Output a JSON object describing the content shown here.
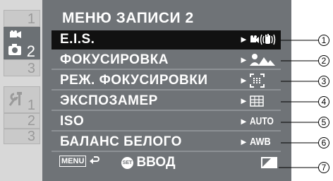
{
  "menu": {
    "title": "МЕНЮ ЗАПИСИ 2",
    "items": [
      {
        "label": "E.I.S.",
        "icon": "eis-video-hand-icon",
        "selected": true
      },
      {
        "label": "ФОКУСИРОВКА",
        "icon": "person-mountain-icon",
        "selected": false
      },
      {
        "label": "РЕЖ. ФОКУСИРОВКИ",
        "icon": "focus-frame-icon",
        "selected": false
      },
      {
        "label": "ЭКСПОЗАМЕР",
        "icon": "grid-metering-icon",
        "selected": false
      },
      {
        "label": "ISO",
        "icon": "auto-text-icon",
        "icon_text": "AUTO",
        "selected": false
      },
      {
        "label": "БАЛАНС БЕЛОГО",
        "icon": "awb-text-icon",
        "icon_text": "AWB",
        "selected": false
      }
    ],
    "arrow": "►"
  },
  "sidebar": {
    "tabs": [
      {
        "number": "1",
        "active": false
      },
      {
        "number": "2",
        "icon": "camera-video-icon",
        "active": true
      },
      {
        "number": "3",
        "active": false
      },
      {
        "number": "1",
        "icon": "tools-icon",
        "active": false
      },
      {
        "number": "2",
        "active": false
      },
      {
        "number": "3",
        "active": false
      }
    ]
  },
  "footer": {
    "menu_label": "MENU",
    "set_label": "SET",
    "enter_label": "ВВОД"
  },
  "callouts": [
    "①",
    "②",
    "③",
    "④",
    "⑤",
    "⑥",
    "⑦"
  ],
  "colors": {
    "panel": "#6f7377",
    "selected_row": "#111111",
    "inactive_tab": "#c9c9c9",
    "text": "#ffffff"
  }
}
